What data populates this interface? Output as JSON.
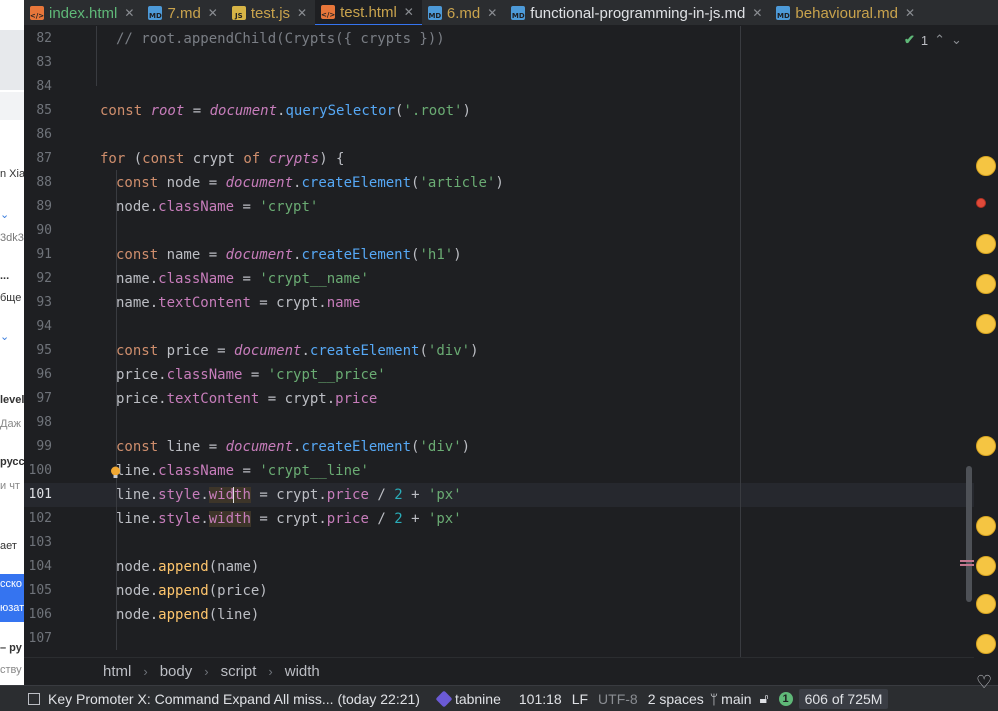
{
  "tabs": [
    {
      "label": "index.html",
      "icon": "html-file-icon",
      "color": "green"
    },
    {
      "label": "7.md",
      "icon": "markdown-file-icon",
      "color": "yellow"
    },
    {
      "label": "test.js",
      "icon": "js-file-icon",
      "color": "yellow"
    },
    {
      "label": "test.html",
      "icon": "html-file-icon",
      "color": "active"
    },
    {
      "label": "6.md",
      "icon": "markdown-file-icon",
      "color": "yellow"
    },
    {
      "label": "functional-programming-in-js.md",
      "icon": "markdown-file-icon",
      "color": "white"
    },
    {
      "label": "behavioural.md",
      "icon": "markdown-file-icon",
      "color": "yellow"
    }
  ],
  "tab_icon_text": {
    "html": "</>",
    "md": "MD",
    "js": "JS"
  },
  "inspections": {
    "count": "1"
  },
  "line_numbers": [
    "82",
    "83",
    "84",
    "85",
    "86",
    "87",
    "88",
    "89",
    "90",
    "91",
    "92",
    "93",
    "94",
    "95",
    "96",
    "97",
    "98",
    "99",
    "100",
    "101",
    "102",
    "103",
    "104",
    "105",
    "106",
    "107"
  ],
  "current_line": "101",
  "code": {
    "l82_comment": "// root.appendChild(Crypts({ crypts }))",
    "l85_const": "const ",
    "l85_root": "root",
    "l85_eq": " = ",
    "l85_doc": "document",
    "l85_dot": ".",
    "l85_qs": "querySelector",
    "l85_open": "(",
    "l85_str": "'.root'",
    "l85_close": ")",
    "l87_for": "for ",
    "l87_open": "(",
    "l87_const": "const ",
    "l87_crypt": "crypt ",
    "l87_of": "of ",
    "l87_crypts": "crypts",
    "l87_close": ") {",
    "l88_const": "const ",
    "l88_node": "node = ",
    "l88_doc": "document",
    "l88_ce": "createElement",
    "l88_str": "'article'",
    "l89_node": "node.",
    "l89_cls": "className",
    "l89_eq": " = ",
    "l89_str": "'crypt'",
    "l91_const": "const ",
    "l91_name": "name = ",
    "l91_doc": "document",
    "l91_ce": "createElement",
    "l91_str": "'h1'",
    "l92_name": "name.",
    "l92_cls": "className",
    "l92_str": "'crypt__name'",
    "l93_name": "name.",
    "l93_tc": "textContent",
    "l93_rest": " = crypt.",
    "l93_prop": "name",
    "l95_const": "const ",
    "l95_price": "price = ",
    "l95_doc": "document",
    "l95_ce": "createElement",
    "l95_str": "'div'",
    "l96_price": "price.",
    "l96_cls": "className",
    "l96_str": "'crypt__price'",
    "l97_price": "price.",
    "l97_tc": "textContent",
    "l97_rest": " = crypt.",
    "l97_prop": "price",
    "l99_const": "const ",
    "l99_line": "line = ",
    "l99_doc": "document",
    "l99_ce": "createElement",
    "l99_str": "'div'",
    "l100_line": "line.",
    "l100_cls": "className",
    "l100_str": "'crypt__line'",
    "l101_line": "line.",
    "l101_style": "style",
    "l101_w1": "wid",
    "l101_w2": "th",
    "l101_rest": " = crypt.",
    "l101_prop": "price",
    "l101_div": " / ",
    "l101_num": "2",
    "l101_plus": " + ",
    "l101_str": "'px'",
    "l102_line": "line.",
    "l102_style": "style",
    "l102_w": "width",
    "l102_rest": " = crypt.",
    "l102_prop": "price",
    "l102_div": " / ",
    "l102_num": "2",
    "l102_plus": " + ",
    "l102_str": "'px'",
    "l104_node": "node.",
    "l104_m": "append",
    "l104_arg": "(name)",
    "l105_node": "node.",
    "l105_m": "append",
    "l105_arg": "(price)",
    "l106_node": "node.",
    "l106_m": "append",
    "l106_arg": "(line)"
  },
  "breadcrumb": [
    "html",
    "body",
    "script",
    "width"
  ],
  "status": {
    "message": "Key Promoter X: Command Expand All miss... (today 22:21)",
    "tabnine": "tabnine",
    "position": "101:18",
    "line_sep": "LF",
    "encoding": "UTF-8",
    "indent": "2 spaces",
    "branch": "main",
    "notifications": "1",
    "memory": "606 of 725M"
  },
  "bg_left_text": [
    "n Xia",
    "3dk3",
    "...",
    "бще",
    "level",
    "Даж",
    "русс",
    "и чт",
    "ает",
    "сско",
    "юзат",
    "– ру",
    "ству"
  ],
  "colors": {
    "accent": "#3574f0",
    "string": "#6aab73",
    "keyword": "#cf8e6d",
    "purple": "#c77dbb",
    "method": "#ffc66d",
    "number": "#2aacb8"
  }
}
